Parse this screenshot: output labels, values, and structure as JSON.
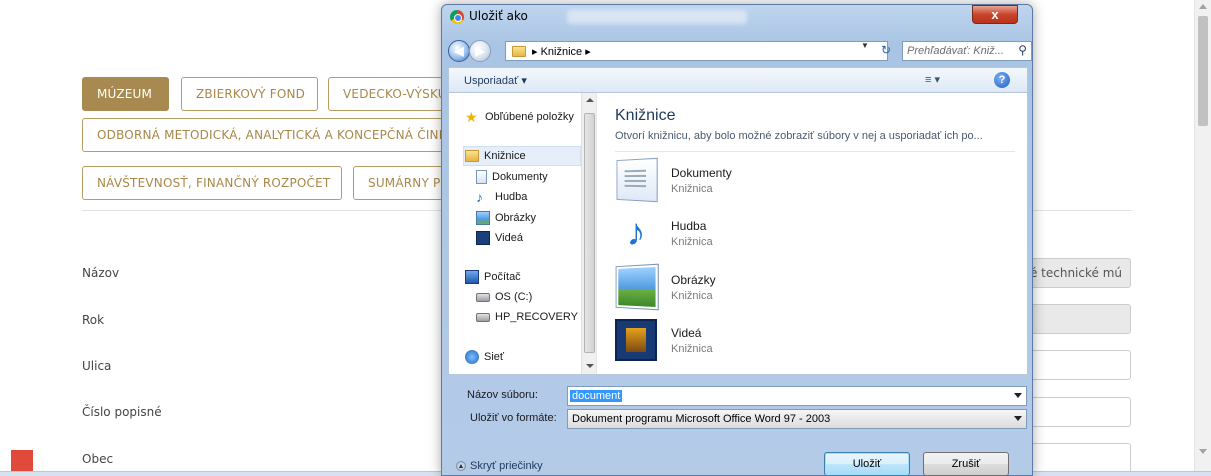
{
  "webpage": {
    "nav": {
      "muzeum": "MÚZEUM",
      "zbierkovy_fond": "ZBIERKOVÝ FOND",
      "vedecko": "VEDECKO-VÝSKU",
      "odborna": "ODBORNÁ METODICKÁ, ANALYTICKÁ A KONCEPČNÁ ČINN",
      "navstevnost": "NÁVŠTEVNOSŤ, FINANČNÝ ROZPOČET",
      "sumarny": "SUMÁRNY P"
    },
    "fields": {
      "nazov_label": "Názov",
      "nazov_value": "ské technické mú",
      "rok_label": "Rok",
      "ulica_label": "Ulica",
      "cislo_label": "Číslo popisné",
      "obec_label": "Obec"
    }
  },
  "dialog": {
    "title": "Uložiť ako",
    "close_symbol": "x",
    "breadcrumb": "▸ Knižnice ▸",
    "search_placeholder": "Prehľadávať: Kniž...",
    "organize_label": "Usporiadať ▾",
    "views_label": "≡ ▾",
    "help_symbol": "?",
    "nav": {
      "favorites": "Obľúbené položky",
      "libraries": "Knižnice",
      "documents": "Dokumenty",
      "music": "Hudba",
      "pictures": "Obrázky",
      "videos": "Videá",
      "computer": "Počítač",
      "os_drive": "OS (C:)",
      "recovery_drive": "HP_RECOVERY (D:",
      "network": "Sieť"
    },
    "main": {
      "title": "Knižnice",
      "description": "Otvorí knižnicu, aby bolo možné zobraziť súbory v nej a usporiadať ich po...",
      "items": [
        {
          "name": "Dokumenty",
          "kind": "Knižnica"
        },
        {
          "name": "Hudba",
          "kind": "Knižnica"
        },
        {
          "name": "Obrázky",
          "kind": "Knižnica"
        },
        {
          "name": "Videá",
          "kind": "Knižnica"
        }
      ]
    },
    "filename_label": "Názov súboru:",
    "filename_value": "document",
    "format_label": "Uložiť vo formáte:",
    "format_value": "Dokument programu Microsoft Office Word 97 - 2003",
    "hide_folders": "Skryť priečinky",
    "save_button": "Uložiť",
    "cancel_button": "Zrušiť"
  },
  "colors": {
    "accent_gold": "#a8894f",
    "dialog_frame": "#b4cbe8",
    "close_red": "#c7442d"
  }
}
